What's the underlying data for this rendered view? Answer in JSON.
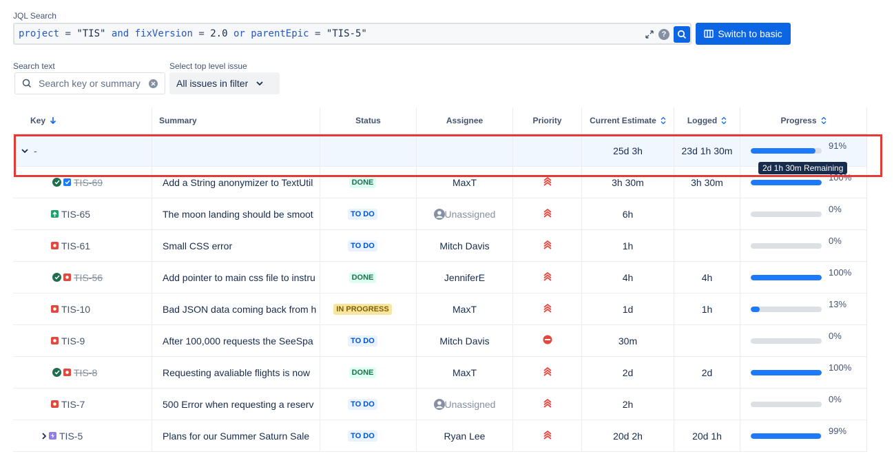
{
  "jql": {
    "label": "JQL Search",
    "query": [
      {
        "t": "kw",
        "v": "project"
      },
      {
        "t": "op",
        "v": " = "
      },
      {
        "t": "str",
        "v": "\"TIS\""
      },
      {
        "t": "kw",
        "v": " and "
      },
      {
        "t": "kw",
        "v": "fixVersion"
      },
      {
        "t": "op",
        "v": " = "
      },
      {
        "t": "str",
        "v": "2.0"
      },
      {
        "t": "kw",
        "v": " or "
      },
      {
        "t": "kw",
        "v": "parentEpic"
      },
      {
        "t": "op",
        "v": " = "
      },
      {
        "t": "str",
        "v": "\"TIS-5\""
      }
    ],
    "help": "?",
    "switch_label": "Switch to basic"
  },
  "filters": {
    "search_label": "Search text",
    "search_placeholder": "Search key or summary",
    "top_level_label": "Select top level issue",
    "top_level_value": "All issues in filter"
  },
  "columns": {
    "key": "Key",
    "summary": "Summary",
    "status": "Status",
    "assignee": "Assignee",
    "priority": "Priority",
    "estimate": "Current Estimate",
    "logged": "Logged",
    "progress": "Progress"
  },
  "group_row": {
    "key": "-",
    "estimate": "25d 3h",
    "logged": "23d 1h 30m",
    "progress": 91,
    "progress_label": "91%",
    "tooltip": "2d 1h 30m Remaining"
  },
  "rows": [
    {
      "key": "TIS-69",
      "done": true,
      "type": "task",
      "summary": "Add a String anonymizer to TextUtil",
      "status": "DONE",
      "status_kind": "done",
      "assignee": "MaxT",
      "unassigned": false,
      "priority": "highest",
      "estimate": "3h 30m",
      "logged": "3h 30m",
      "progress": 100,
      "progress_label": "100%"
    },
    {
      "key": "TIS-65",
      "done": false,
      "type": "improvement",
      "summary": "The moon landing should be smoot",
      "status": "TO DO",
      "status_kind": "todo",
      "assignee": "Unassigned",
      "unassigned": true,
      "priority": "highest",
      "estimate": "6h",
      "logged": "",
      "progress": 0,
      "progress_label": "0%"
    },
    {
      "key": "TIS-61",
      "done": false,
      "type": "bug",
      "summary": "Small CSS error",
      "status": "TO DO",
      "status_kind": "todo",
      "assignee": "Mitch Davis",
      "unassigned": false,
      "priority": "highest",
      "estimate": "1h",
      "logged": "",
      "progress": 0,
      "progress_label": "0%"
    },
    {
      "key": "TIS-56",
      "done": true,
      "type": "bug",
      "summary": "Add pointer to main css file to instru",
      "status": "DONE",
      "status_kind": "done",
      "assignee": "JenniferE",
      "unassigned": false,
      "priority": "highest",
      "estimate": "4h",
      "logged": "4h",
      "progress": 100,
      "progress_label": "100%"
    },
    {
      "key": "TIS-10",
      "done": false,
      "type": "bug",
      "summary": "Bad JSON data coming back from h",
      "status": "IN PROGRESS",
      "status_kind": "prog",
      "assignee": "MaxT",
      "unassigned": false,
      "priority": "highest",
      "estimate": "1d",
      "logged": "1h",
      "progress": 13,
      "progress_label": "13%"
    },
    {
      "key": "TIS-9",
      "done": false,
      "type": "bug",
      "summary": "After 100,000 requests the SeeSpa",
      "status": "TO DO",
      "status_kind": "todo",
      "assignee": "Mitch Davis",
      "unassigned": false,
      "priority": "blocker",
      "estimate": "30m",
      "logged": "",
      "progress": 0,
      "progress_label": "0%"
    },
    {
      "key": "TIS-8",
      "done": true,
      "type": "bug",
      "summary": "Requesting avaliable flights is now",
      "status": "DONE",
      "status_kind": "done",
      "assignee": "MaxT",
      "unassigned": false,
      "priority": "highest",
      "estimate": "2d",
      "logged": "2d",
      "progress": 100,
      "progress_label": "100%"
    },
    {
      "key": "TIS-7",
      "done": false,
      "type": "bug",
      "summary": "500 Error when requesting a reserv",
      "status": "TO DO",
      "status_kind": "todo",
      "assignee": "Unassigned",
      "unassigned": true,
      "priority": "highest",
      "estimate": "2h",
      "logged": "",
      "progress": 0,
      "progress_label": "0%"
    },
    {
      "key": "TIS-5",
      "done": false,
      "type": "epic",
      "expandable": true,
      "summary": "Plans for our Summer Saturn Sale",
      "status": "TO DO",
      "status_kind": "todo",
      "assignee": "Ryan Lee",
      "unassigned": false,
      "priority": "highest",
      "estimate": "20d 2h",
      "logged": "20d 1h",
      "progress": 99,
      "progress_label": "99%"
    }
  ],
  "colors": {
    "accent": "#0c66e4",
    "bar": "#1d7afc",
    "priority_highest": "#e2483d",
    "bug": "#e2483d",
    "task": "#1d7afc",
    "improvement": "#22a06b",
    "epic": "#8f7ee7"
  }
}
